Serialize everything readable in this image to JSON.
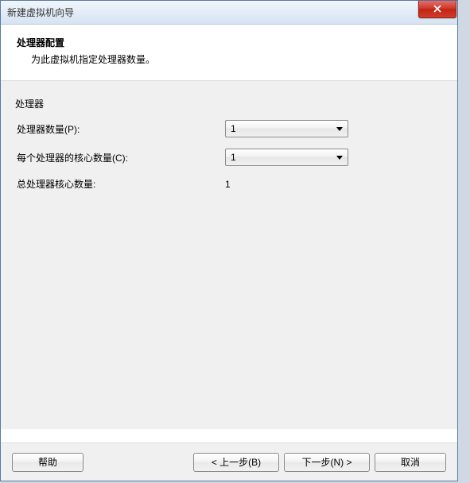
{
  "titlebar": {
    "title": "新建虚拟机向导"
  },
  "header": {
    "title": "处理器配置",
    "subtitle": "为此虚拟机指定处理器数量。"
  },
  "form": {
    "group_label": "处理器",
    "processors_label": "处理器数量(P):",
    "processors_value": "1",
    "cores_label": "每个处理器的核心数量(C):",
    "cores_value": "1",
    "total_label": "总处理器核心数量:",
    "total_value": "1"
  },
  "footer": {
    "help": "帮助",
    "back": "< 上一步(B)",
    "next": "下一步(N) >",
    "cancel": "取消"
  }
}
